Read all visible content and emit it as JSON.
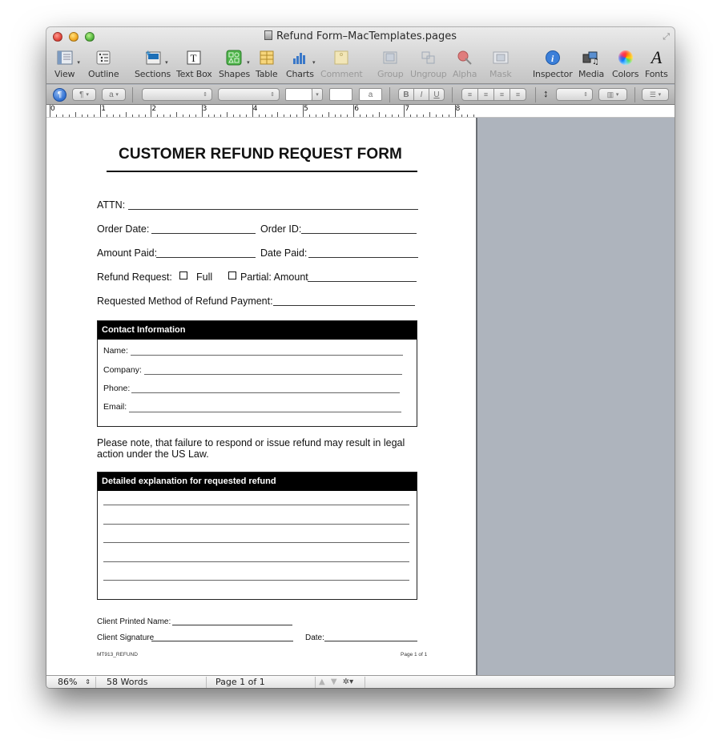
{
  "window": {
    "title": "Refund Form–MacTemplates.pages",
    "fullscreen_icon": "fullscreen-arrows-icon"
  },
  "toolbar": {
    "items": [
      {
        "label": "View",
        "icon": "view-icon",
        "enabled": true,
        "has_menu": true
      },
      {
        "label": "Outline",
        "icon": "outline-icon",
        "enabled": true,
        "has_menu": false
      },
      {
        "label": "Sections",
        "icon": "sections-icon",
        "enabled": true,
        "has_menu": true
      },
      {
        "label": "Text Box",
        "icon": "text-box-icon",
        "enabled": true,
        "has_menu": false
      },
      {
        "label": "Shapes",
        "icon": "shapes-icon",
        "enabled": true,
        "has_menu": true
      },
      {
        "label": "Table",
        "icon": "table-icon",
        "enabled": true,
        "has_menu": false
      },
      {
        "label": "Charts",
        "icon": "charts-icon",
        "enabled": true,
        "has_menu": true
      },
      {
        "label": "Comment",
        "icon": "comment-icon",
        "enabled": false,
        "has_menu": false
      },
      {
        "label": "Group",
        "icon": "group-icon",
        "enabled": false,
        "has_menu": false
      },
      {
        "label": "Ungroup",
        "icon": "ungroup-icon",
        "enabled": false,
        "has_menu": false
      },
      {
        "label": "Alpha",
        "icon": "alpha-icon",
        "enabled": false,
        "has_menu": false
      },
      {
        "label": "Mask",
        "icon": "mask-icon",
        "enabled": false,
        "has_menu": false
      },
      {
        "label": "Inspector",
        "icon": "inspector-icon",
        "enabled": true,
        "has_menu": false
      },
      {
        "label": "Media",
        "icon": "media-icon",
        "enabled": true,
        "has_menu": false
      },
      {
        "label": "Colors",
        "icon": "colors-icon",
        "enabled": true,
        "has_menu": false
      },
      {
        "label": "Fonts",
        "icon": "fonts-icon",
        "enabled": true,
        "has_menu": false
      }
    ]
  },
  "formatbar": {
    "paragraph_style_glyph": "¶",
    "character_style_glyph": "a",
    "font_family": "",
    "font_style": "",
    "font_size": "",
    "text_color_glyph": "",
    "highlight_glyph": "a",
    "bold": "B",
    "italic": "I",
    "underline": "U",
    "line_spacing": "",
    "arrow_down": "▾",
    "stepper": "⇕"
  },
  "ruler": {
    "labels": [
      "0",
      "1",
      "2",
      "3",
      "4",
      "5",
      "6",
      "7",
      "8"
    ]
  },
  "document": {
    "title": "CUSTOMER REFUND REQUEST FORM",
    "attn_label": "ATTN:",
    "order_date_label": "Order Date:",
    "order_id_label": "Order ID:",
    "amount_paid_label": "Amount Paid:",
    "date_paid_label": "Date Paid:",
    "refund_request_label": "Refund Request:",
    "full_label": "Full",
    "partial_label": "Partial: Amount",
    "full_checked": false,
    "partial_checked": false,
    "method_label": "Requested Method of Refund Payment:",
    "contact": {
      "heading": "Contact Information",
      "fields": [
        "Name:",
        "Company:",
        "Phone:",
        "Email:"
      ]
    },
    "note": "Please note, that failure to respond or issue refund may result in legal action under the US Law.",
    "explanation": {
      "heading": "Detailed explanation for requested refund",
      "line_count": 5
    },
    "client_printed_name_label": "Client Printed Name:",
    "client_signature_label": "Client Signature",
    "date_label": "Date:",
    "footer_code": "MT913_REFUND",
    "footer_page": "Page 1 of 1"
  },
  "statusbar": {
    "zoom": "86%",
    "zoom_stepper": "⇕",
    "word_count": "58 Words",
    "page_indicator": "Page 1 of 1",
    "prev_icon": "▲",
    "next_icon": "▼",
    "gear_icon": "✲▾"
  }
}
